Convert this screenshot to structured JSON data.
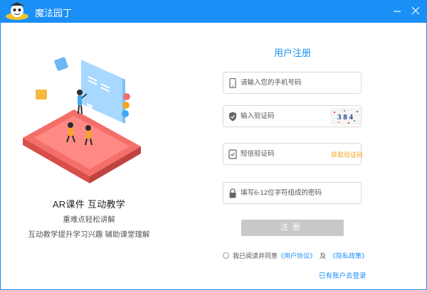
{
  "app": {
    "title": "魔法园丁"
  },
  "hero": {
    "title": "AR课件  互动教学",
    "subtitle1": "重难点轻松讲解",
    "subtitle2": "互动教学提升学习兴趣  辅助课堂理解"
  },
  "form": {
    "title": "用户注册",
    "phone_placeholder": "请输入您的手机号码",
    "captcha_placeholder": "输入验证码",
    "captcha_text": "3 8 4",
    "sms_placeholder": "短信验证码",
    "sms_button": "获取验证码",
    "password_placeholder": "填写6-12位字符组成的密码",
    "register_button": "注册"
  },
  "agreement": {
    "prefix": "我已阅读并同意",
    "user_agreement": "《用户协议》",
    "and": "及",
    "privacy_policy": "《隐私政策》"
  },
  "login_link": "已有账户去登录",
  "colors": {
    "accent": "#1a8ff5",
    "button_disabled": "#c8c8c8",
    "sms_link": "#f5a623",
    "platform": "#f46f6a"
  },
  "icons": {
    "phone": "phone-icon",
    "captcha": "shield-icon",
    "sms": "message-check-icon",
    "password": "lock-icon",
    "minimize": "minimize-icon",
    "close": "close-icon"
  }
}
